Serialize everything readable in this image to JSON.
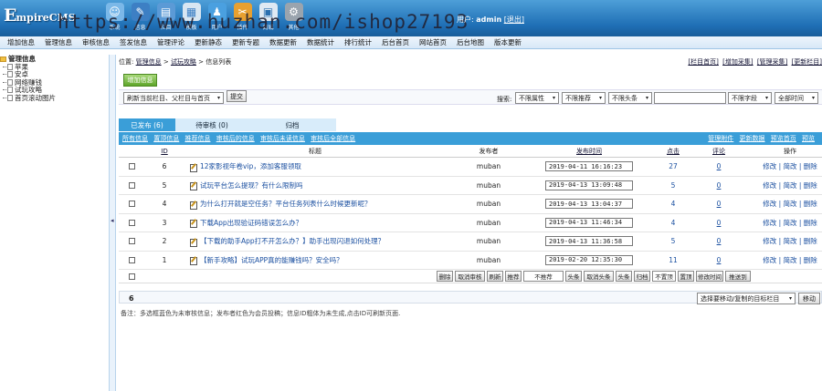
{
  "header": {
    "logo_main": "E",
    "logo_rest": "mpireCMS",
    "watermark": "https://www.huzhan.com/ishop27193",
    "icons": [
      {
        "name": "user-icon",
        "label": "系统"
      },
      {
        "name": "pencil-icon",
        "label": "信息"
      },
      {
        "name": "folder-icon",
        "label": "栏目"
      },
      {
        "name": "template-icon",
        "label": "模板"
      },
      {
        "name": "member-icon",
        "label": "用户"
      },
      {
        "name": "plugin-icon",
        "label": "插件"
      },
      {
        "name": "shop-icon",
        "label": "商城"
      },
      {
        "name": "gear-icon",
        "label": "其他"
      }
    ],
    "user_label": "用户:",
    "user_name": "admin",
    "logout": "[退出]",
    "icon_colors": [
      "#7bb8e8",
      "#3d7fc4",
      "#5b9ad6",
      "#e8f0f8",
      "#4aa0e0",
      "#e8a030",
      "#dfe9f3",
      "#c0c8d0"
    ]
  },
  "menu": [
    "增加信息",
    "管理信息",
    "审核信息",
    "签发信息",
    "管理评论",
    "更新静态",
    "更新专题",
    "数据更新",
    "数据统计",
    "排行统计",
    "后台首页",
    "网站首页",
    "后台地图",
    "版本更新"
  ],
  "tree": {
    "root": "管理信息",
    "items": [
      "苹果",
      "安卓",
      "网络赚钱",
      "试玩攻略",
      "首页滚动图片"
    ]
  },
  "crumb": {
    "prefix": "位置:",
    "path1": "管理信息",
    "sep": ">",
    "path2": "试玩攻略",
    "sep2": ">",
    "path3": "信息列表",
    "links": [
      "[栏目首页]",
      "[增加采集]",
      "[管理采集]",
      "[更新栏目]"
    ]
  },
  "toolbar": {
    "add_button": "增加信息",
    "refresh_select": "刷新当前栏目、父栏目与首页",
    "submit": "提交",
    "search_label": "搜索:",
    "filter1": "不限属性",
    "filter2": "不限推荐",
    "filter3": "不限头条",
    "field_select": "不限字段",
    "time_select": "全部时间",
    "search_value": ""
  },
  "tabs": [
    {
      "label": "已发布 (6)",
      "active": true
    },
    {
      "label": "待审核 (0)",
      "active": false
    },
    {
      "label": "归档",
      "active": false
    }
  ],
  "filterbar": {
    "left": [
      "所有信息",
      "置顶信息",
      "推荐信息",
      "审核后的信息",
      "审核后未读信息",
      "审核后全部信息"
    ],
    "right": [
      "管理附件",
      "更新数据",
      "预览首页",
      "预览"
    ]
  },
  "columns": [
    "ID",
    "标题",
    "发布者",
    "发布时间",
    "点击",
    "评论",
    "操作"
  ],
  "rows": [
    {
      "id": "6",
      "title": "12家影视年卷vip，添加客服领取",
      "author": "muban",
      "time": "2019-04-11 16:16:23",
      "clicks": "27",
      "comments": "0",
      "ops": "修改 | 简改 | 删除"
    },
    {
      "id": "5",
      "title": "试玩平台怎么提现？有什么限制吗",
      "author": "muban",
      "time": "2019-04-13 13:09:48",
      "clicks": "5",
      "comments": "0",
      "ops": "修改 | 简改 | 删除"
    },
    {
      "id": "4",
      "title": "为什么打开就是空任务？平台任务列表什么时候更新呢？",
      "author": "muban",
      "time": "2019-04-13 13:04:37",
      "clicks": "4",
      "comments": "0",
      "ops": "修改 | 简改 | 删除"
    },
    {
      "id": "3",
      "title": "下载App出现验证码错误怎么办？",
      "author": "muban",
      "time": "2019-04-13 11:46:34",
      "clicks": "4",
      "comments": "0",
      "ops": "修改 | 简改 | 删除"
    },
    {
      "id": "2",
      "title": "【下载的助手App打不开怎么办？】助手出现闪退如何处理？",
      "author": "muban",
      "time": "2019-04-13 11:36:58",
      "clicks": "5",
      "comments": "0",
      "ops": "修改 | 简改 | 删除"
    },
    {
      "id": "1",
      "title": "【新手攻略】试玩APP真的能赚钱吗？安全吗？",
      "author": "muban",
      "time": "2019-02-20 12:35:30",
      "clicks": "11",
      "comments": "0",
      "ops": "修改 | 简改 | 删除"
    }
  ],
  "batch": {
    "buttons": [
      "删除",
      "取消审核",
      "刷新",
      "推荐",
      "不推荐",
      "头条",
      "取消头条",
      "头条",
      "归档",
      "不置顶",
      "置顶",
      "修改时间",
      "推送到"
    ],
    "count": "6",
    "move_select": "选择要移动/复制的目标栏目",
    "move_button": "移动"
  },
  "note": "备注：多选框蓝色为未审核信息；发布者红色为会员投稿；信息ID粗体为未生成,点击ID可刷新页面."
}
